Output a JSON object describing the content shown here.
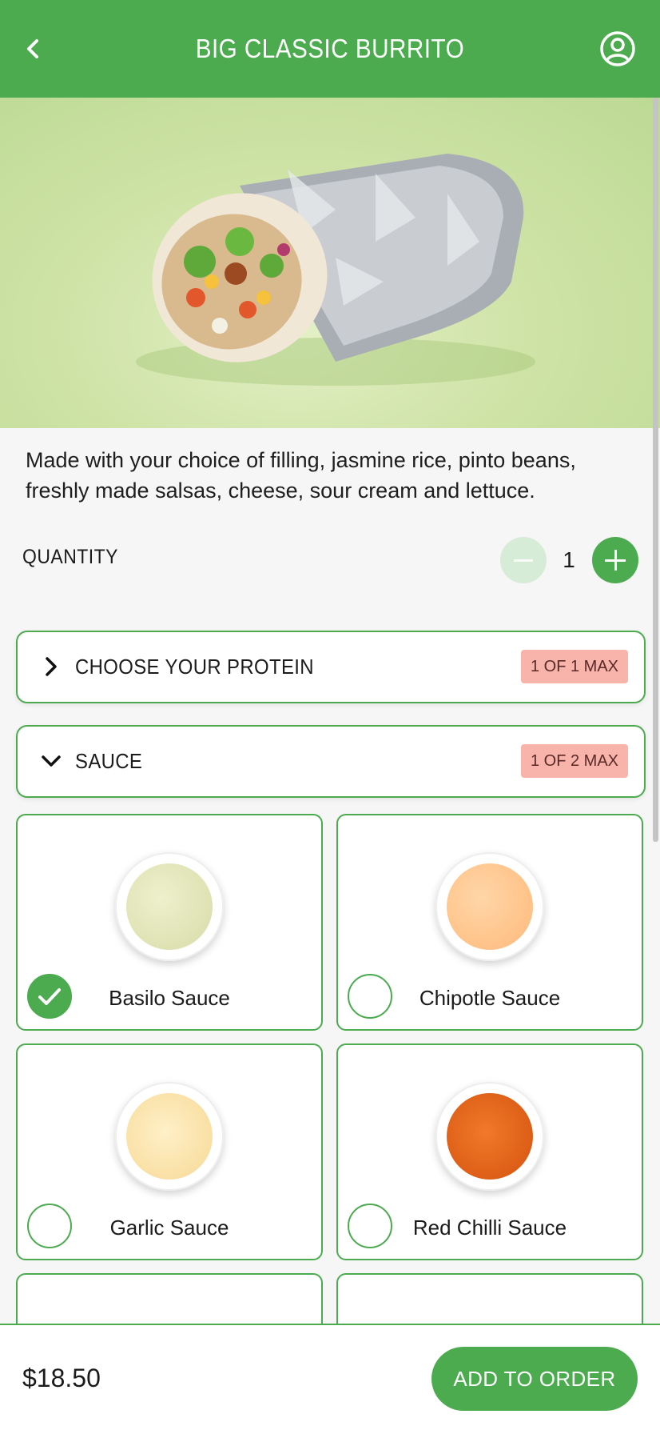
{
  "header": {
    "title": "BIG CLASSIC BURRITO",
    "back_icon": "chevron-left-icon",
    "user_icon": "user-circle-icon"
  },
  "description": "Made with your choice of filling, jasmine rice, pinto beans, freshly made salsas, cheese, sour cream and lettuce.",
  "quantity": {
    "label": "QUANTITY",
    "value": "1"
  },
  "sections": [
    {
      "label": "CHOOSE YOUR PROTEIN",
      "badge": "1 OF 1 MAX",
      "expanded": false
    },
    {
      "label": "SAUCE",
      "badge": "1 OF 2 MAX",
      "expanded": true
    }
  ],
  "sauces": [
    {
      "name": "Basilo Sauce",
      "selected": true,
      "color": "#dfe3b9"
    },
    {
      "name": "Chipotle Sauce",
      "selected": false,
      "color": "#ffc48a"
    },
    {
      "name": "Garlic Sauce",
      "selected": false,
      "color": "#fbe1a8"
    },
    {
      "name": "Red Chilli Sauce",
      "selected": false,
      "color": "#e8681c"
    }
  ],
  "footer": {
    "price": "$18.50",
    "add_label": "ADD TO ORDER"
  },
  "colors": {
    "brand": "#4bab4e",
    "badge_bg": "#f8b3ab"
  }
}
